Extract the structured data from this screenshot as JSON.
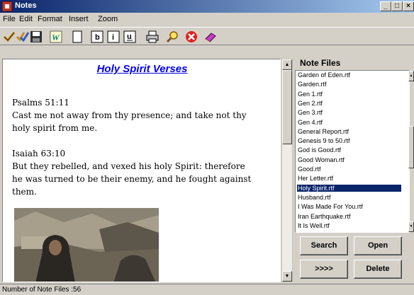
{
  "window": {
    "title": "Notes",
    "minimize": "_",
    "maximize": "□",
    "close": "×"
  },
  "menu": [
    "File",
    "Edit",
    "Format",
    "Insert",
    "Zoom"
  ],
  "toolbar": {
    "icons": [
      "check-icon",
      "double-check-icon",
      "save-icon",
      "wordpad-icon",
      "new-document-icon",
      "bold-icon",
      "italic-icon",
      "underline-icon",
      "print-icon",
      "find-icon",
      "cancel-icon",
      "book-icon"
    ],
    "bold": "b",
    "italic": "i",
    "underline": "u"
  },
  "document": {
    "title": "Holy Spirit Verses",
    "lines": [
      "Psalms  51:11",
      "Cast me not away from thy presence; and take not thy",
      "holy spirit from me.",
      "",
      "Isaiah  63:10",
      "But they rebelled, and vexed his holy Spirit: therefore",
      "he was turned to be their enemy, and he fought against",
      "them."
    ],
    "link_color": "#0000ee"
  },
  "notes": {
    "title": "Note Files",
    "files": [
      "Garden of Eden.rtf",
      "Garden.rtf",
      "Gen 1.rtf",
      "Gen 2.rtf",
      "Gen 3.rtf",
      "Gen 4.rtf",
      "General Report.rtf",
      "Genesis 9 to 50.rtf",
      "God is Good.rtf",
      "Good Woman.rtf",
      "Good.rtf",
      "Her Letter.rtf",
      "Holy Spirit.rtf",
      "Husband.rtf",
      "I Was Made For You.rtf",
      "Iran Earthquake.rtf",
      "It Is Well.rtf"
    ],
    "selected_index": 12,
    "selection_color": "#0a246a"
  },
  "buttons": {
    "search": "Search",
    "open": "Open",
    "next": ">>>>",
    "delete": "Delete"
  },
  "status": {
    "text": "Number of Note Files :56"
  }
}
